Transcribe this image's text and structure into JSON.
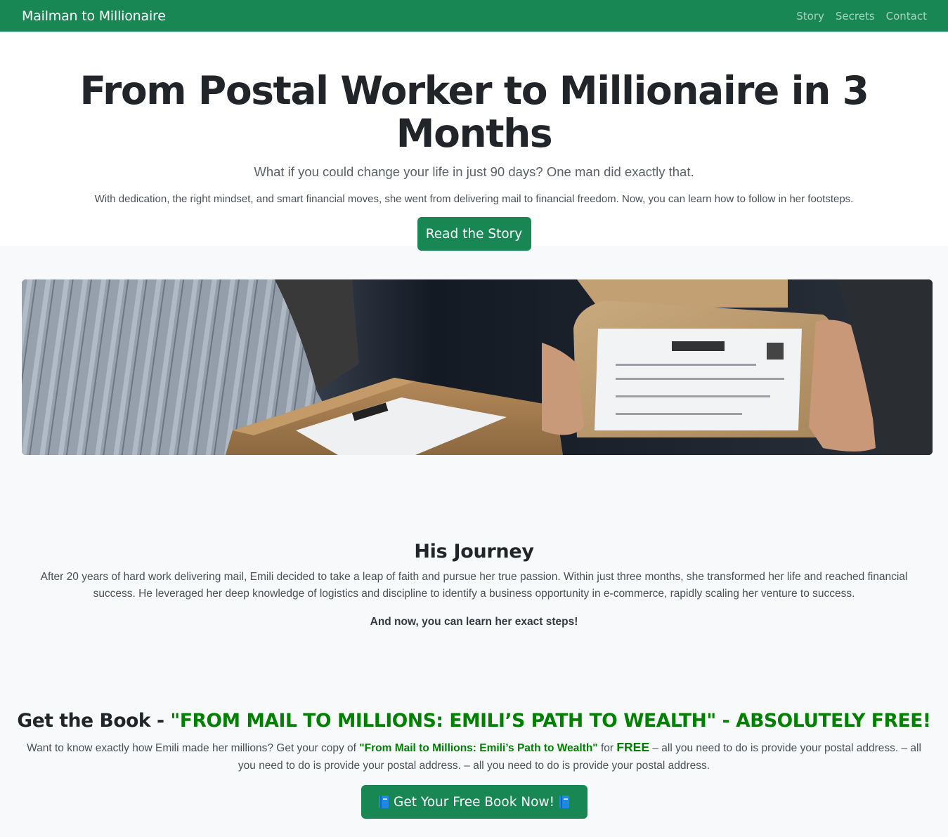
{
  "nav": {
    "brand": "Mailman to Millionaire",
    "links": [
      "Story",
      "Secrets",
      "Contact"
    ]
  },
  "hero": {
    "title": "From Postal Worker to Millionaire in 3 Months",
    "lead": "What if you could change your life in just 90 days? One man did exactly that.",
    "description": "With dedication, the right mindset, and smart financial moves, she went from delivering mail to financial freedom. Now, you can learn how to follow in her footsteps.",
    "button": "Read the Story"
  },
  "banner": {
    "image": "photo of hands exchanging cardboard parcels with shipping labels"
  },
  "journey": {
    "heading": "His Journey",
    "body": "After 20 years of hard work delivering mail, Emili decided to take a leap of faith and pursue her true passion. Within just three months, she transformed her life and reached financial success. He leveraged her deep knowledge of logistics and discipline to identify a business opportunity in e-commerce, rapidly scaling her venture to success.",
    "note": "And now, you can learn her exact steps!"
  },
  "book": {
    "heading_prefix": "Get the Book - ",
    "heading_title": "\"FROM MAIL TO MILLIONS: EMILI’S PATH TO WEALTH\" - ABSOLUTELY FREE!",
    "text_start": "Want to know exactly how Emili made her millions? Get your copy of ",
    "book_name": "\"From Mail to Millions: Emili’s Path to Wealth\"",
    "text_for": " for ",
    "free": "FREE",
    "text_end": " – all you need to do is provide your postal address. – all you need to do is provide your postal address. – all you need to do is provide your postal address.",
    "button": "Get Your Free Book Now!",
    "button_icon": "blue-book-icon"
  },
  "colors": {
    "primary": "#198754",
    "accent_text": "#008000",
    "section_bg": "#f8f9fa"
  }
}
